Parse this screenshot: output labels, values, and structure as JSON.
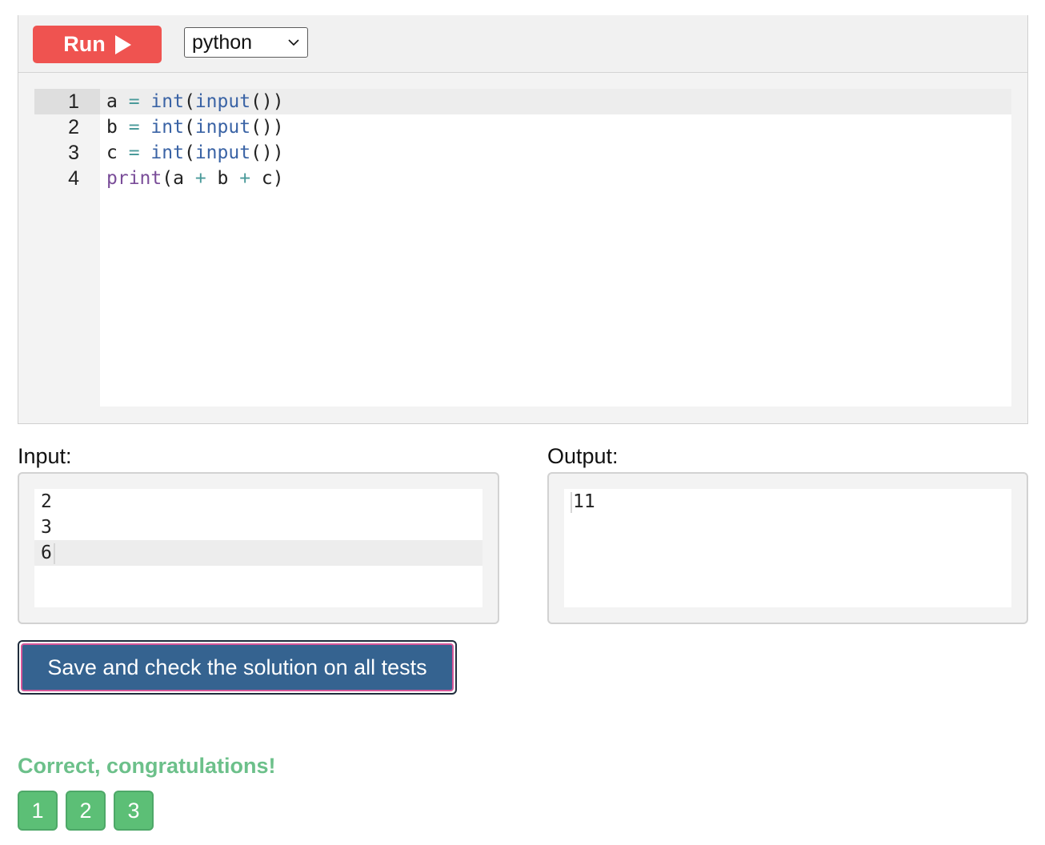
{
  "toolbar": {
    "run_label": "Run",
    "language": "python"
  },
  "editor": {
    "line_numbers": [
      "1",
      "2",
      "3",
      "4"
    ],
    "lines": [
      [
        [
          "a ",
          "plain"
        ],
        [
          "=",
          "op"
        ],
        [
          " ",
          "plain"
        ],
        [
          "int",
          "builtin"
        ],
        [
          "(",
          "paren"
        ],
        [
          "input",
          "builtin"
        ],
        [
          "())",
          "paren"
        ]
      ],
      [
        [
          "b ",
          "plain"
        ],
        [
          "=",
          "op"
        ],
        [
          " ",
          "plain"
        ],
        [
          "int",
          "builtin"
        ],
        [
          "(",
          "paren"
        ],
        [
          "input",
          "builtin"
        ],
        [
          "())",
          "paren"
        ]
      ],
      [
        [
          "c ",
          "plain"
        ],
        [
          "=",
          "op"
        ],
        [
          " ",
          "plain"
        ],
        [
          "int",
          "builtin"
        ],
        [
          "(",
          "paren"
        ],
        [
          "input",
          "builtin"
        ],
        [
          "())",
          "paren"
        ]
      ],
      [
        [
          "print",
          "print"
        ],
        [
          "(",
          "paren"
        ],
        [
          "a ",
          "plain"
        ],
        [
          "+",
          "op"
        ],
        [
          " b ",
          "plain"
        ],
        [
          "+",
          "op"
        ],
        [
          " c)",
          "plain"
        ]
      ]
    ]
  },
  "input": {
    "label": "Input:",
    "lines": [
      "2",
      "3",
      "6"
    ]
  },
  "output": {
    "label": "Output:",
    "lines": [
      "11"
    ]
  },
  "submit": {
    "label": "Save and check the solution on all tests"
  },
  "result": {
    "message": "Correct, congratulations!",
    "tests": [
      "1",
      "2",
      "3"
    ]
  },
  "colors": {
    "run_button": "#ef5350",
    "submit_button": "#356390",
    "success": "#5cbf76"
  }
}
